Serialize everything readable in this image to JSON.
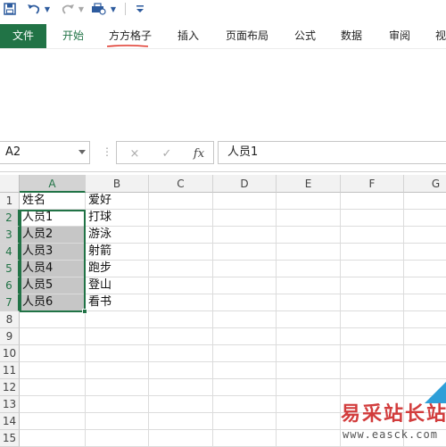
{
  "quick_access": {
    "icons": [
      "save-icon",
      "undo-icon",
      "undo-dropdown-icon",
      "redo-icon",
      "redo-dropdown-icon",
      "print-preview-icon",
      "customize-dropdown-icon"
    ],
    "accent": "#2d5b9e"
  },
  "ribbon": {
    "tabs": [
      "文件",
      "开始",
      "方方格子",
      "插入",
      "页面布局",
      "公式",
      "数据",
      "审阅",
      "视"
    ],
    "file_color": "#217346",
    "underline_color": "#e0382d"
  },
  "formula_bar": {
    "name_box": "A2",
    "cancel_icon": "×",
    "enter_icon": "✓",
    "function_label": "fx",
    "formula": "人员1"
  },
  "grid": {
    "columns": [
      "A",
      "B",
      "C",
      "D",
      "E",
      "F",
      "G"
    ],
    "selected_column": "A",
    "rows": [
      "1",
      "2",
      "3",
      "4",
      "5",
      "6",
      "7",
      "8",
      "9",
      "10",
      "11",
      "12",
      "13",
      "14",
      "15"
    ],
    "cells": [
      [
        "姓名",
        "爱好"
      ],
      [
        "人员1",
        "打球"
      ],
      [
        "人员2",
        "游泳"
      ],
      [
        "人员3",
        "射箭"
      ],
      [
        "人员4",
        "跑步"
      ],
      [
        "人员5",
        "登山"
      ],
      [
        "人员6",
        "看书"
      ]
    ],
    "selection": "A2:A7",
    "active_cell": "A2",
    "selection_color": "#217346"
  },
  "watermark": {
    "title": "易采站长站",
    "url": "www.easck.com",
    "title_color": "#d23c3c",
    "corner_color": "#2f9fd8"
  }
}
